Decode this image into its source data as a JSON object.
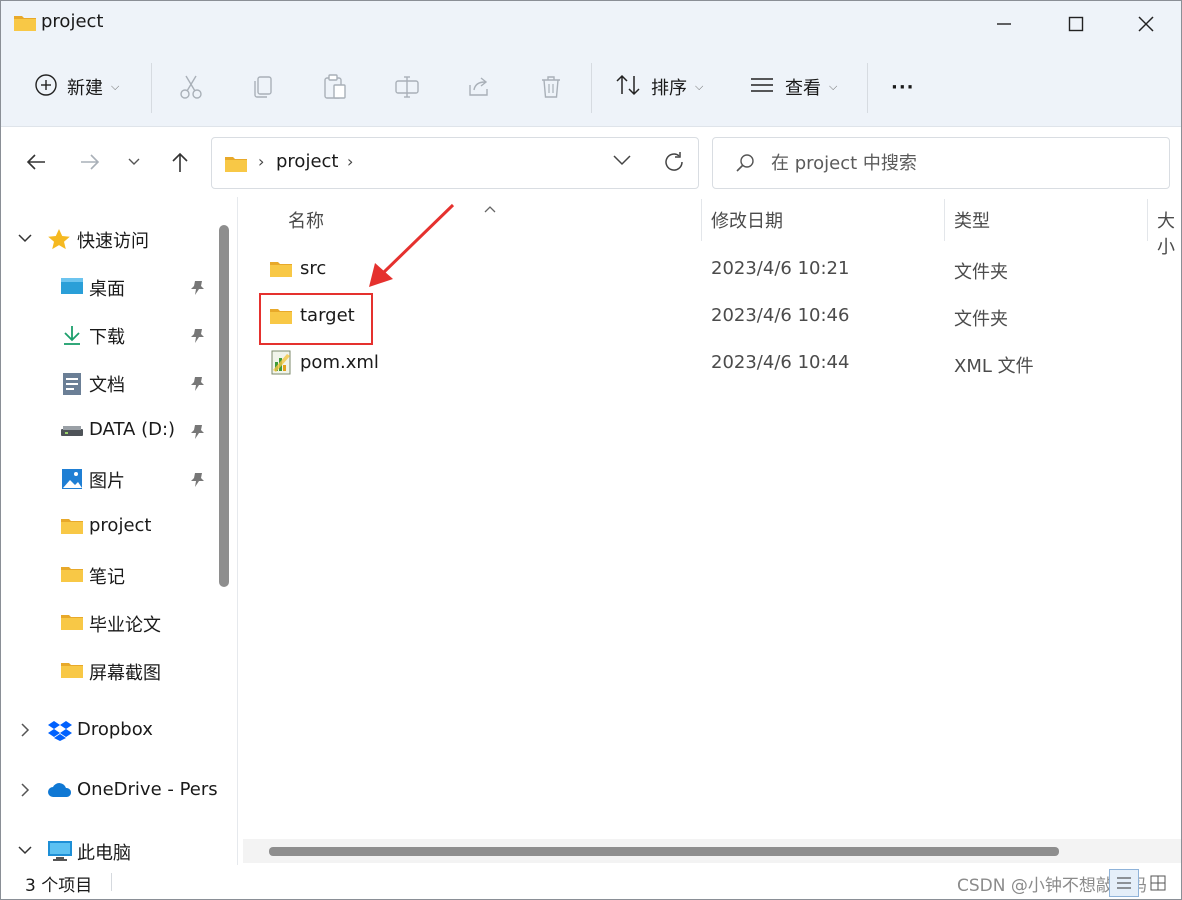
{
  "window": {
    "title": "project"
  },
  "toolbar": {
    "new_label": "新建",
    "sort_label": "排序",
    "view_label": "查看",
    "more_label": "···"
  },
  "address": {
    "crumb": "project",
    "separator": "›"
  },
  "search": {
    "placeholder": "在 project 中搜索"
  },
  "sidebar": {
    "quick_access": "快速访问",
    "items": [
      {
        "label": "桌面",
        "icon": "desktop-icon",
        "pinned": true
      },
      {
        "label": "下载",
        "icon": "download-icon",
        "pinned": true
      },
      {
        "label": "文档",
        "icon": "documents-icon",
        "pinned": true
      },
      {
        "label": "DATA (D:)",
        "icon": "drive-icon",
        "pinned": true
      },
      {
        "label": "图片",
        "icon": "pictures-icon",
        "pinned": true
      },
      {
        "label": "project",
        "icon": "folder-icon",
        "pinned": false
      },
      {
        "label": "笔记",
        "icon": "folder-icon",
        "pinned": false
      },
      {
        "label": "毕业论文",
        "icon": "folder-icon",
        "pinned": false
      },
      {
        "label": "屏幕截图",
        "icon": "folder-icon",
        "pinned": false
      }
    ],
    "dropbox": "Dropbox",
    "onedrive": "OneDrive - Pers",
    "this_pc": "此电脑"
  },
  "columns": {
    "name": "名称",
    "modified": "修改日期",
    "type": "类型",
    "size": "大小"
  },
  "files": [
    {
      "name": "src",
      "modified": "2023/4/6 10:21",
      "type": "文件夹",
      "icon": "folder-icon"
    },
    {
      "name": "target",
      "modified": "2023/4/6 10:46",
      "type": "文件夹",
      "icon": "folder-icon"
    },
    {
      "name": "pom.xml",
      "modified": "2023/4/6 10:44",
      "type": "XML 文件",
      "icon": "xml-file-icon"
    }
  ],
  "status": {
    "item_count": "3 个项目"
  },
  "watermark": "CSDN @小钟不想敲代码",
  "colors": {
    "folder": "#f8c846",
    "highlight": "#e5312e",
    "accent": "#0067c0"
  }
}
